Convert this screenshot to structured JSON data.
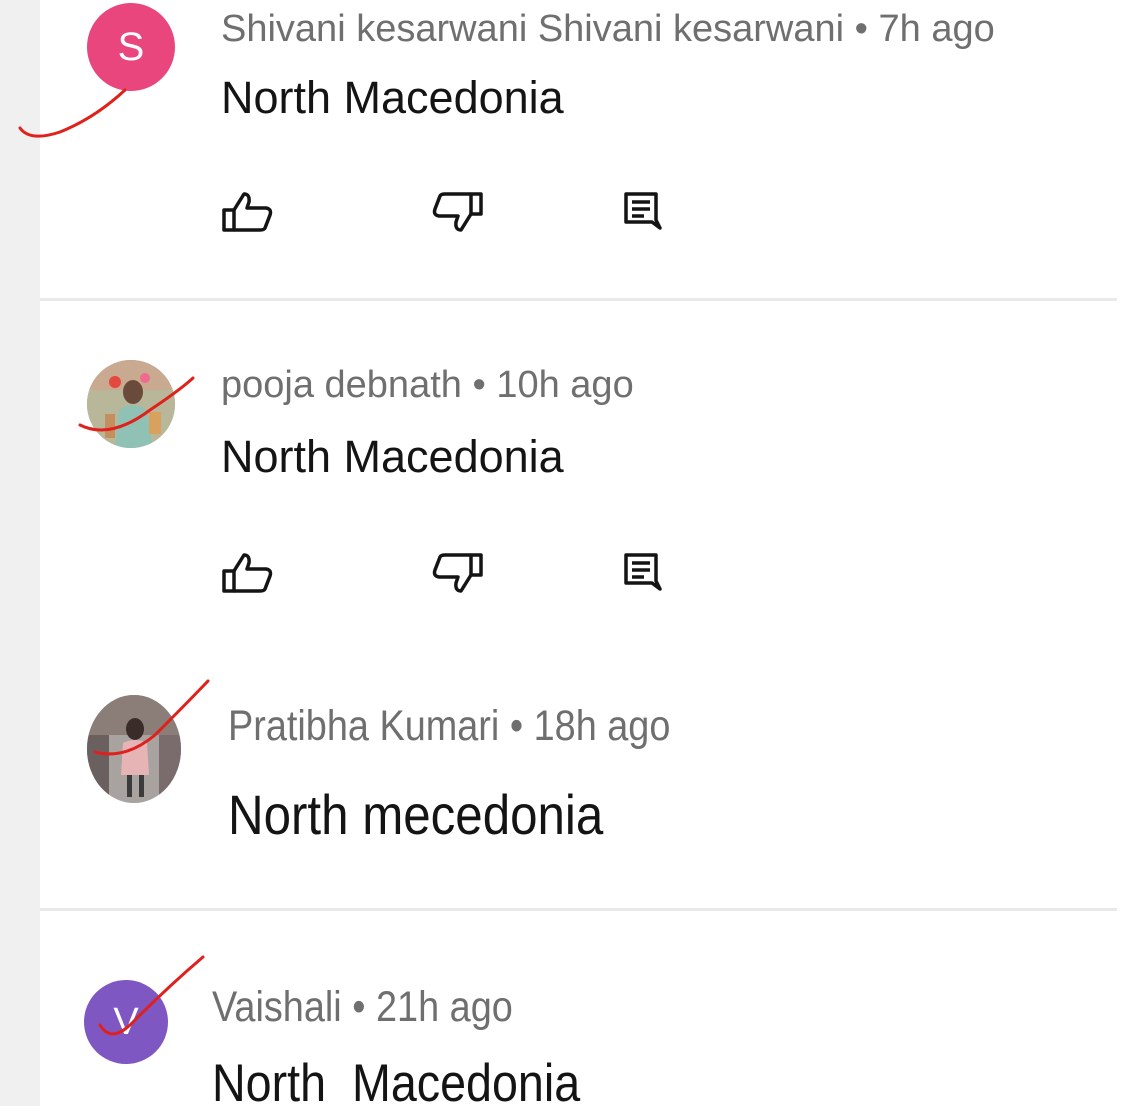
{
  "colors": {
    "avatar_s": "#e8467c",
    "avatar_v": "#7e57c2",
    "meta_text": "#6f6f6f",
    "body_text": "#141414",
    "ink_mark": "#e0201b"
  },
  "comments": [
    {
      "avatar_letter": "S",
      "author": "Shivani kesarwani Shivani kesarwani",
      "separator": "•",
      "time": "7h ago",
      "text": "North Macedonia",
      "actions": [
        "thumbs-up-icon",
        "thumbs-down-icon",
        "reply-icon"
      ]
    },
    {
      "avatar_letter": "",
      "author": "pooja debnath",
      "separator": "•",
      "time": "10h ago",
      "text": "North Macedonia",
      "actions": [
        "thumbs-up-icon",
        "thumbs-down-icon",
        "reply-icon"
      ]
    },
    {
      "avatar_letter": "",
      "author": "Pratibha Kumari",
      "separator": "•",
      "time": "18h ago",
      "text": "North mecedonia"
    },
    {
      "avatar_letter": "V",
      "author": "Vaishali",
      "separator": "•",
      "time": "21h ago",
      "text": "North  Macedonia"
    }
  ]
}
